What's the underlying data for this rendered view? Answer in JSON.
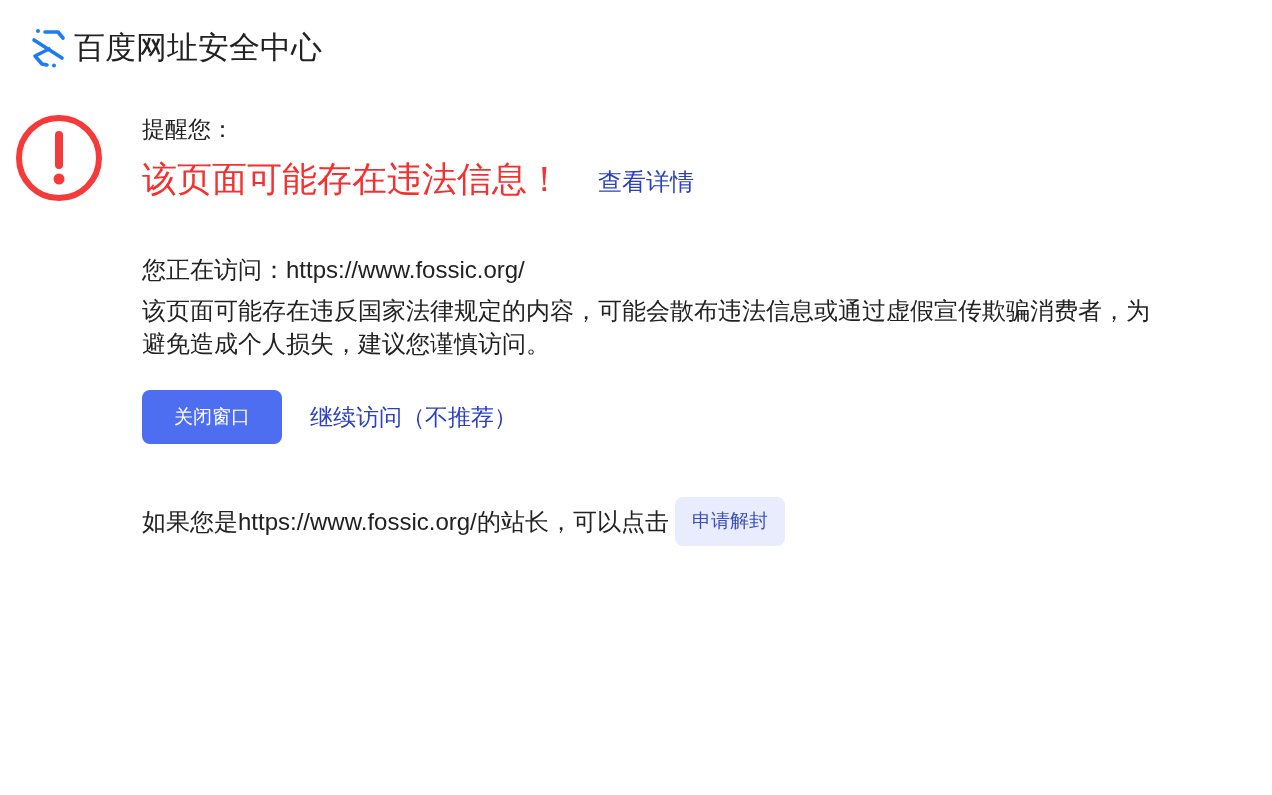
{
  "header": {
    "title": "百度网址安全中心"
  },
  "alert": {
    "label": "提醒您：",
    "headline": "该页面可能存在违法信息！",
    "details_link": "查看详情"
  },
  "visiting": "您正在访问：https://www.fossic.org/",
  "description": "该页面可能存在违反国家法律规定的内容，可能会散布违法信息或通过虚假宣传欺骗消费者，为避免造成个人损失，建议您谨慎访问。",
  "actions": [
    {
      "kind": "primary",
      "label": "关闭窗口"
    },
    {
      "kind": "link",
      "label": "继续访问（不推荐）"
    }
  ],
  "owner_note": {
    "text": "如果您是https://www.fossic.org/的站长，可以点击",
    "button": "申请解封"
  }
}
